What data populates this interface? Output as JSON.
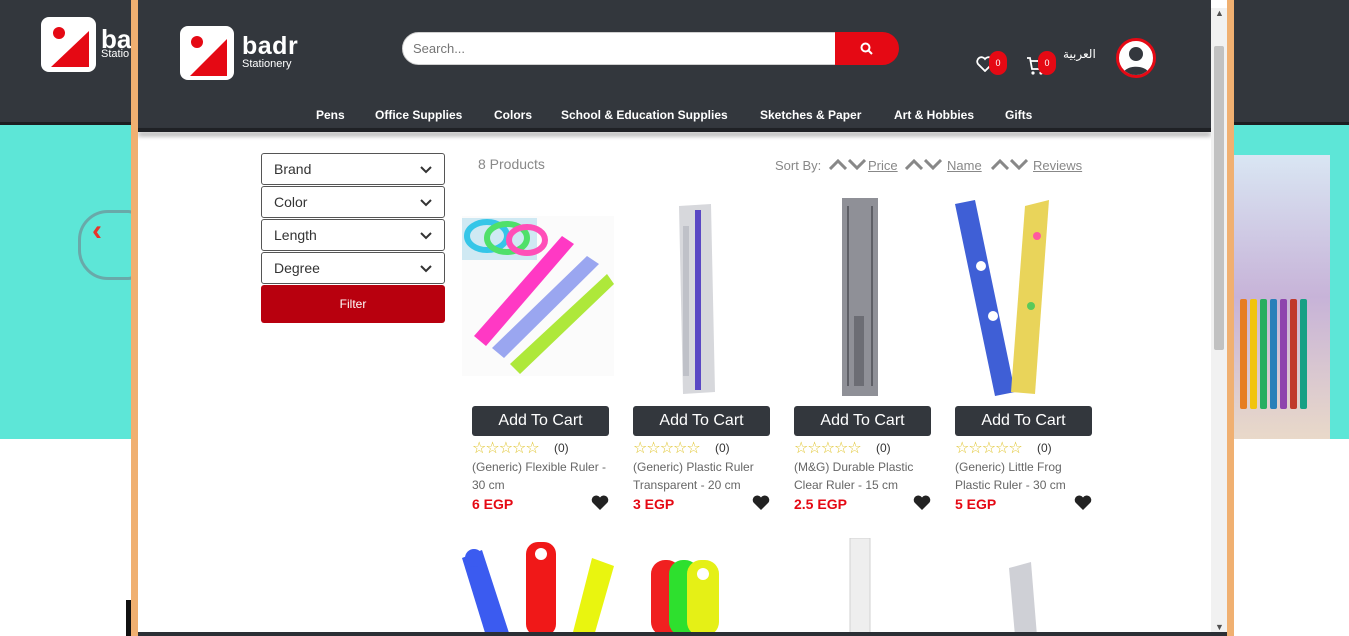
{
  "background_page": {
    "logo_name": "badr",
    "logo_sub": "Statio"
  },
  "header": {
    "logo_name": "badr",
    "logo_sub": "Stationery",
    "search_placeholder": "Search...",
    "wishlist_count": "0",
    "cart_count": "0",
    "language": "العربية"
  },
  "nav": {
    "items": [
      "Pens",
      "Office Supplies",
      "Colors",
      "School & Education Supplies",
      "Sketches & Paper",
      "Art & Hobbies",
      "Gifts"
    ]
  },
  "filters": {
    "selects": [
      "Brand",
      "Color",
      "Length",
      "Degree"
    ],
    "button": "Filter"
  },
  "results": {
    "count": "8 Products",
    "sort_by": "Sort By:",
    "sort_options": [
      "Price",
      "Name",
      "Reviews"
    ]
  },
  "products": [
    {
      "name": "(Generic) Flexible Ruler - 30 cm",
      "price": "6 EGP",
      "rating_count": "(0)",
      "cart_label": "Add To Cart"
    },
    {
      "name": "(Generic) Plastic Ruler Transparent - 20 cm",
      "price": "3 EGP",
      "rating_count": "(0)",
      "cart_label": "Add To Cart"
    },
    {
      "name": "(M&G) Durable Plastic Clear Ruler - 15 cm",
      "price": "2.5 EGP",
      "rating_count": "(0)",
      "cart_label": "Add To Cart"
    },
    {
      "name": "(Generic) Little Frog Plastic Ruler - 30 cm",
      "price": "5 EGP",
      "rating_count": "(0)",
      "cart_label": "Add To Cart"
    }
  ],
  "colors": {
    "header_bg": "#33373d",
    "accent_red": "#e50914",
    "filter_red": "#b8000e",
    "modal_border": "#f0b071",
    "banner": "#5de6d7",
    "star": "#e0c52e"
  },
  "icons": {
    "search": "search-icon",
    "wishlist": "heart-outline-icon",
    "cart": "cart-icon",
    "avatar": "user-icon",
    "dropdown": "chevron-down-icon",
    "sort_up": "chevron-up-icon",
    "sort_down": "chevron-down-icon",
    "favorite": "heart-icon",
    "rating": "star-outline-icon"
  }
}
